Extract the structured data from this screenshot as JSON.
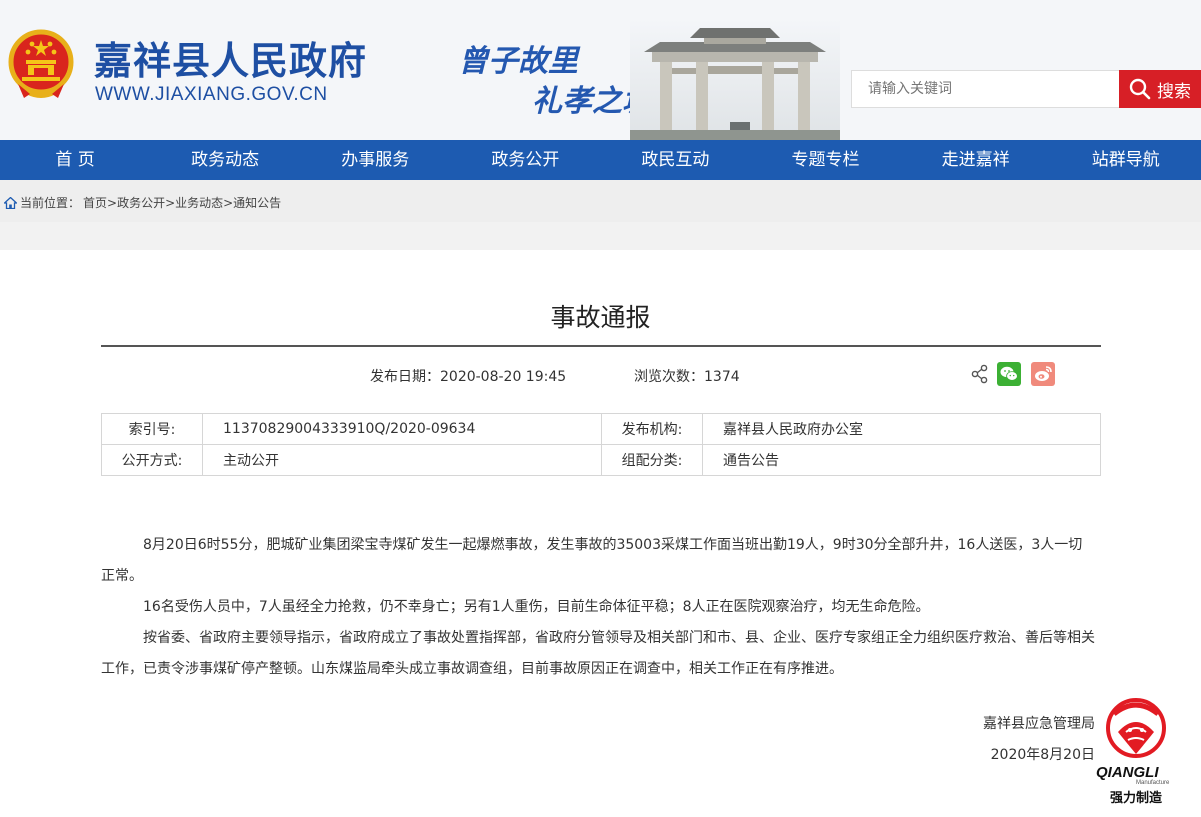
{
  "header": {
    "site_title": "嘉祥县人民政府",
    "site_url": "WWW.JIAXIANG.GOV.CN",
    "slogan_line1": "曾子故里",
    "slogan_line2": "礼孝之城",
    "search_placeholder": "请输入关键词",
    "search_button": "搜索"
  },
  "nav": {
    "items": [
      "首 页",
      "政务动态",
      "办事服务",
      "政务公开",
      "政民互动",
      "专题专栏",
      "走进嘉祥",
      "站群导航"
    ]
  },
  "breadcrumb": {
    "prefix": "当前位置：",
    "path": "首页>政务公开>业务动态>通知公告"
  },
  "article": {
    "title": "事故通报",
    "publish_date_label": "发布日期：",
    "publish_date": "2020-08-20 19:45",
    "views_label": "浏览次数：",
    "views": "1374",
    "info": {
      "index_label": "索引号:",
      "index_value": "11370829004333910Q/2020-09634",
      "org_label": "发布机构:",
      "org_value": "嘉祥县人民政府办公室",
      "open_label": "公开方式:",
      "open_value": "主动公开",
      "category_label": "组配分类:",
      "category_value": "通告公告"
    },
    "paragraphs": [
      "8月20日6时55分，肥城矿业集团梁宝寺煤矿发生一起爆燃事故，发生事故的35003采煤工作面当班出勤19人，9时30分全部升井，16人送医，3人一切正常。",
      "16名受伤人员中，7人虽经全力抢救，仍不幸身亡；另有1人重伤，目前生命体征平稳；8人正在医院观察治疗，均无生命危险。",
      "按省委、省政府主要领导指示，省政府成立了事故处置指挥部，省政府分管领导及相关部门和市、县、企业、医疗专家组正全力组织医疗救治、善后等相关工作，已责令涉事煤矿停产整顿。山东煤监局牵头成立事故调查组，目前事故原因正在调查中，相关工作正在有序推进。"
    ],
    "signature_org": "嘉祥县应急管理局",
    "signature_date": "2020年8月20日"
  },
  "watermark": {
    "brand": "QIANGLI",
    "sub": "Manufacture",
    "cn": "强力制造"
  },
  "colors": {
    "brand_blue": "#1d5bb1",
    "search_red": "#d71f26"
  }
}
